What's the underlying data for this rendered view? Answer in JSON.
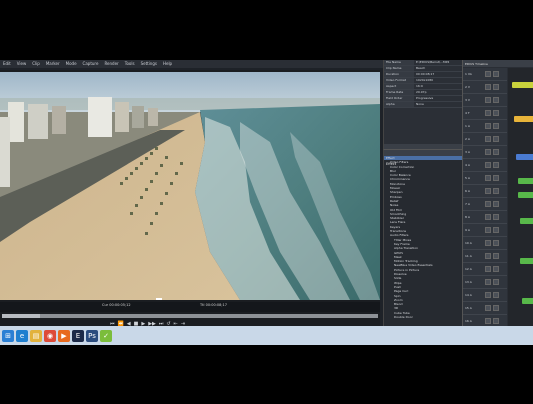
{
  "menubar": [
    "Edit",
    "View",
    "Clip",
    "Marker",
    "Mode",
    "Capture",
    "Render",
    "Tools",
    "Settings",
    "Help"
  ],
  "clip_properties": [
    {
      "key": "File Name",
      "value": "E:\\EDIUS\\Beirut\\...MP4"
    },
    {
      "key": "Clip Name",
      "value": "Beach"
    },
    {
      "key": "Duration",
      "value": "00:00:08;17"
    },
    {
      "key": "Video Format",
      "value": "1920x1080"
    },
    {
      "key": "Aspect",
      "value": "16:9"
    },
    {
      "key": "Frame Rate",
      "value": "29.97p"
    },
    {
      "key": "Field Order",
      "value": "Progressive"
    },
    {
      "key": "Alpha",
      "value": "None"
    }
  ],
  "information_tab": "Information",
  "effect_panel_title": "Effect",
  "effect_tree": [
    "Effect",
    "Video Filters",
    "Color Correction",
    "Blur",
    "Color Balance",
    "Chrominance",
    "Monotone",
    "Mosaic",
    "Sharpen",
    "Emboss",
    "Relief",
    "Noise",
    "Old Film",
    "Smoothing",
    "Stabilizer",
    "Lens Flare",
    "Keyers",
    "Transitions",
    "Audio Filters",
    "Titler Mixes",
    "Key Frame",
    "Alpha Transition",
    "GPUfx",
    "Mask",
    "Motion Tracking",
    "NewBlue Video Essentials",
    "Picture in Picture",
    "Dissolve",
    "Slide",
    "Wipe",
    "Push",
    "Page Curl",
    "Spin",
    "Zoom",
    "Blend",
    "3D",
    "Cube Tube",
    "Double Door"
  ],
  "timeline": {
    "title": "EDIUS  Timeline",
    "tracks": [
      "1 VA",
      "2 V",
      "3 V",
      "4 T",
      "1 A",
      "2 A",
      "3 A",
      "4 A",
      "5 A",
      "6 A",
      "7 A",
      "8 A",
      "9 A",
      "10 A",
      "11 A",
      "12 A",
      "13 A",
      "14 A",
      "15 A",
      "16 A"
    ]
  },
  "viewer": {
    "timecode_in": "Cur 00:00:05;12",
    "timecode_out": "Ttl 00:00:08;17",
    "progress": 0.1
  },
  "transport": [
    "⏮",
    "⏪",
    "◀",
    "■",
    "▶",
    "▶▶",
    "⏭",
    "↺",
    "⇤",
    "⇥"
  ],
  "taskbar_icons": [
    {
      "name": "start-icon",
      "color": "#2a7fd4",
      "glyph": "⊞"
    },
    {
      "name": "ie-icon",
      "color": "#1f7fcf",
      "glyph": "e"
    },
    {
      "name": "folder-icon",
      "color": "#e2b23b",
      "glyph": "▤"
    },
    {
      "name": "chrome-icon",
      "color": "#dd4b39",
      "glyph": "◉"
    },
    {
      "name": "media-icon",
      "color": "#e86a1e",
      "glyph": "▶"
    },
    {
      "name": "edius-icon",
      "color": "#1c2a48",
      "glyph": "E"
    },
    {
      "name": "ps-icon",
      "color": "#2b4c7e",
      "glyph": "Ps"
    },
    {
      "name": "app-icon",
      "color": "#7bbd3b",
      "glyph": "✓"
    }
  ]
}
